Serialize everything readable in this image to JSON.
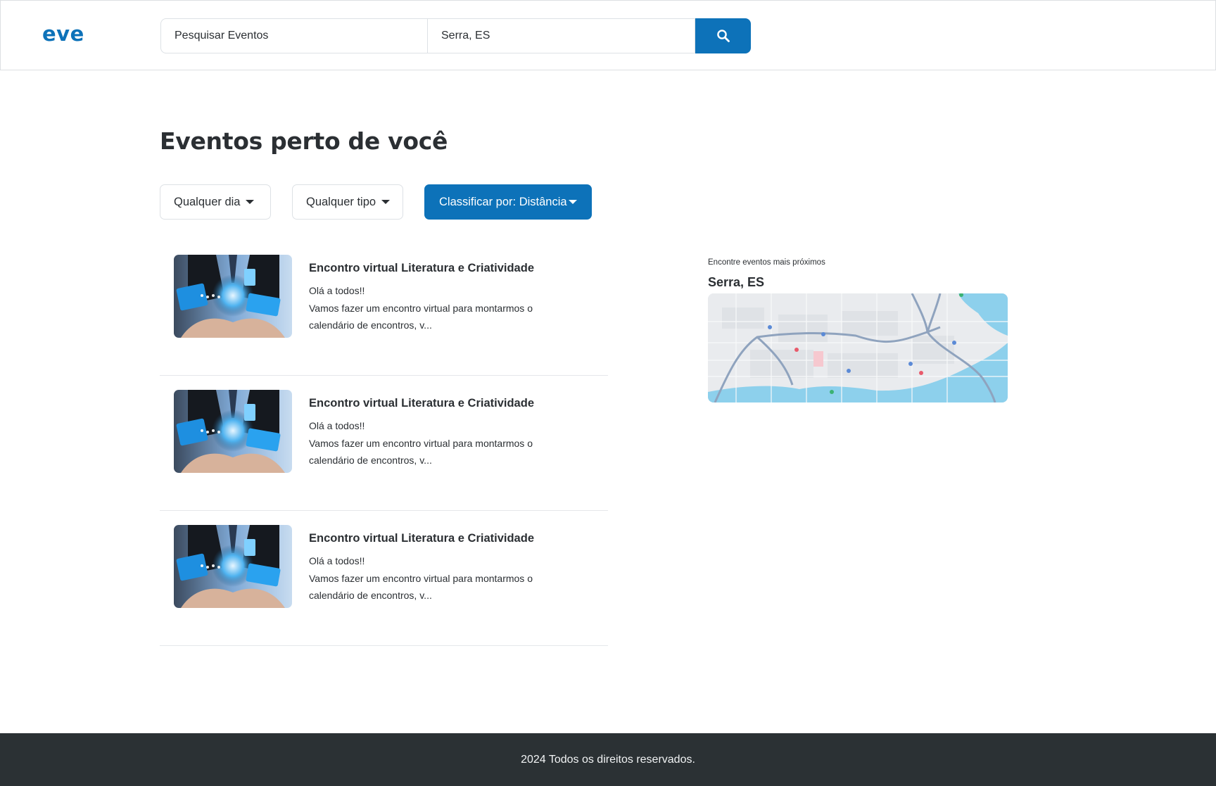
{
  "header": {
    "logo": "eve",
    "search": {
      "events_value": "Pesquisar Eventos",
      "location_value": "Serra, ES",
      "button_icon": "search-icon"
    }
  },
  "main": {
    "title": "Eventos perto de você",
    "filters": {
      "day": "Qualquer dia",
      "type": "Qualquer tipo",
      "sort": "Classificar por: Distância"
    },
    "events": [
      {
        "title": "Encontro virtual Literatura e Criatividade",
        "greeting": "Olá a todos!!",
        "description": "Vamos fazer um encontro virtual para montarmos o calendário de encontros, v..."
      },
      {
        "title": "Encontro virtual Literatura e Criatividade",
        "greeting": "Olá a todos!!",
        "description": "Vamos fazer um encontro virtual para montarmos o calendário de encontros, v..."
      },
      {
        "title": "Encontro virtual Literatura e Criatividade",
        "greeting": "Olá a todos!!",
        "description": "Vamos fazer um encontro virtual para montarmos o calendário de encontros, v..."
      }
    ]
  },
  "map_panel": {
    "hint": "Encontre eventos mais próximos",
    "city": "Serra, ES"
  },
  "footer": {
    "text": "2024 Todos os direitos reservados."
  },
  "colors": {
    "brand": "#0d72b9",
    "footer_bg": "#2b3134",
    "text": "#2b2f33"
  }
}
